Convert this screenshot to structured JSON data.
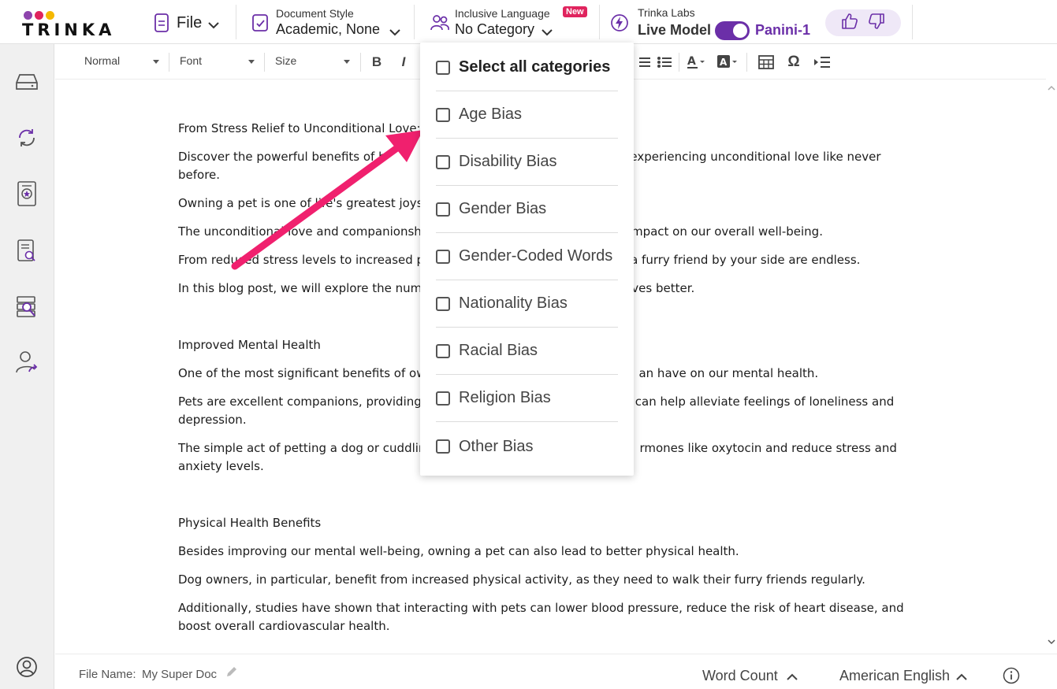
{
  "app": {
    "logo_text": "TRINKA",
    "logo_dot_colors": [
      "#8e44ad",
      "#e0245e",
      "#f5b800"
    ]
  },
  "header": {
    "file_label": "File",
    "document_style": {
      "title": "Document Style",
      "value": "Academic, None"
    },
    "inclusive_language": {
      "title": "Inclusive Language",
      "badge": "New",
      "value": "No Category"
    },
    "trinka_labs": {
      "title": "Trinka Labs",
      "mode": "Live Model",
      "model": "Panini-1",
      "toggle_on": true
    }
  },
  "format_toolbar": {
    "paragraph_style": "Normal",
    "font": "Font",
    "size": "Size",
    "bold": "B",
    "italic": "I",
    "omega": "Ω"
  },
  "dropdown": {
    "select_all": "Select all categories",
    "items": [
      "Age Bias",
      "Disability Bias",
      "Gender Bias",
      "Gender-Coded Words",
      "Nationality Bias",
      "Racial Bias",
      "Religion Bias",
      "Other Bias"
    ]
  },
  "document": {
    "paragraphs": [
      "From Stress Relief to Unconditional Love:",
      "Discover the powerful benefits of h",
      "to experiencing unconditional love like never before.",
      "Owning a pet is one of life's greatest joys.",
      "The unconditional love and companionsh",
      "impact on our overall well-being.",
      "From reduced stress levels to increased p",
      "a furry friend by your side are endless.",
      "In this blog post, we will explore the num",
      "ves better.",
      "Improved Mental Health",
      "One of the most significant benefits of ow",
      "an have on our mental health.",
      "Pets are excellent companions, providing",
      "can help alleviate feelings of loneliness and depression.",
      "The simple act of petting a dog or cuddlin",
      "rmones like oxytocin and reduce stress and anxiety levels.",
      "Physical Health Benefits",
      "Besides improving our mental well-being, owning a pet can also lead to better physical health.",
      "Dog owners, in particular, benefit from increased physical activity, as they need to walk their furry friends regularly.",
      "Additionally, studies have shown that interacting with pets can lower blood pressure, reduce the risk of heart disease, and boost overall cardiovascular health."
    ]
  },
  "footer": {
    "file_name_label": "File Name:",
    "file_name": "My Super Doc",
    "word_count": "Word Count",
    "language": "American English"
  },
  "colors": {
    "accent_purple": "#6b2fa8",
    "badge_red": "#e0245e",
    "arrow_pink": "#f0206e"
  },
  "icons": {
    "sidebar": [
      "drive-icon",
      "sync-icon",
      "certificate-icon",
      "document-search-icon",
      "library-search-icon",
      "user-share-icon",
      "account-icon"
    ]
  }
}
